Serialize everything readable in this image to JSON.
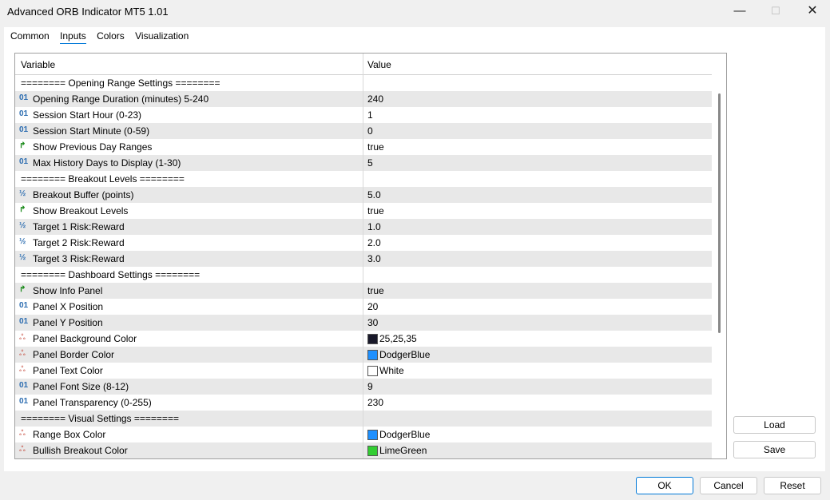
{
  "window": {
    "title": "Advanced ORB Indicator MT5 1.01",
    "minimize": "—",
    "maximize": "☐",
    "close": "✕"
  },
  "tabs": [
    {
      "label": "Common"
    },
    {
      "label": "Inputs",
      "active": true
    },
    {
      "label": "Colors"
    },
    {
      "label": "Visualization"
    }
  ],
  "grid": {
    "header": {
      "variable": "Variable",
      "value": "Value"
    },
    "rows": [
      {
        "type": "section",
        "variable": "======== Opening Range Settings ========",
        "value": ""
      },
      {
        "type": "int",
        "icon": "int-icon",
        "glyph": "01",
        "variable": "Opening Range Duration (minutes) 5-240",
        "value": "240"
      },
      {
        "type": "int",
        "icon": "int-icon",
        "glyph": "01",
        "variable": "Session Start Hour (0-23)",
        "value": "1"
      },
      {
        "type": "int",
        "icon": "int-icon",
        "glyph": "01",
        "variable": "Session Start Minute (0-59)",
        "value": "0"
      },
      {
        "type": "bool",
        "icon": "bool-icon",
        "glyph": "↱",
        "variable": "Show Previous Day Ranges",
        "value": "true"
      },
      {
        "type": "int",
        "icon": "int-icon",
        "glyph": "01",
        "variable": "Max History Days to Display (1-30)",
        "value": "5"
      },
      {
        "type": "section",
        "variable": "======== Breakout Levels ========",
        "value": ""
      },
      {
        "type": "double",
        "icon": "double-icon",
        "glyph": "½",
        "variable": "Breakout Buffer (points)",
        "value": "5.0"
      },
      {
        "type": "bool",
        "icon": "bool-icon",
        "glyph": "↱",
        "variable": "Show Breakout Levels",
        "value": "true"
      },
      {
        "type": "double",
        "icon": "double-icon",
        "glyph": "½",
        "variable": "Target 1 Risk:Reward",
        "value": "1.0"
      },
      {
        "type": "double",
        "icon": "double-icon",
        "glyph": "½",
        "variable": "Target 2 Risk:Reward",
        "value": "2.0"
      },
      {
        "type": "double",
        "icon": "double-icon",
        "glyph": "½",
        "variable": "Target 3 Risk:Reward",
        "value": "3.0"
      },
      {
        "type": "section",
        "variable": "======== Dashboard Settings ========",
        "value": ""
      },
      {
        "type": "bool",
        "icon": "bool-icon",
        "glyph": "↱",
        "variable": "Show Info Panel",
        "value": "true"
      },
      {
        "type": "int",
        "icon": "int-icon",
        "glyph": "01",
        "variable": "Panel X Position",
        "value": "20"
      },
      {
        "type": "int",
        "icon": "int-icon",
        "glyph": "01",
        "variable": "Panel Y Position",
        "value": "30"
      },
      {
        "type": "color",
        "icon": "color-icon",
        "glyph": "ஃ",
        "variable": "Panel Background Color",
        "value": "25,25,35",
        "swatch": "#19192a"
      },
      {
        "type": "color",
        "icon": "color-icon",
        "glyph": "ஃ",
        "variable": "Panel Border Color",
        "value": "DodgerBlue",
        "swatch": "#1e90ff"
      },
      {
        "type": "color",
        "icon": "color-icon",
        "glyph": "ஃ",
        "variable": "Panel Text Color",
        "value": "White",
        "swatch": "#ffffff"
      },
      {
        "type": "int",
        "icon": "int-icon",
        "glyph": "01",
        "variable": "Panel Font Size (8-12)",
        "value": "9"
      },
      {
        "type": "int",
        "icon": "int-icon",
        "glyph": "01",
        "variable": "Panel Transparency (0-255)",
        "value": "230"
      },
      {
        "type": "section",
        "variable": "======== Visual Settings ========",
        "value": ""
      },
      {
        "type": "color",
        "icon": "color-icon",
        "glyph": "ஃ",
        "variable": "Range Box Color",
        "value": "DodgerBlue",
        "swatch": "#1e90ff"
      },
      {
        "type": "color",
        "icon": "color-icon",
        "glyph": "ஃ",
        "variable": "Bullish Breakout Color",
        "value": "LimeGreen",
        "swatch": "#32cd32"
      }
    ]
  },
  "side_buttons": {
    "load": "Load",
    "save": "Save"
  },
  "footer_buttons": {
    "ok": "OK",
    "cancel": "Cancel",
    "reset": "Reset"
  },
  "colors": {
    "int_icon": "#2b6cb0",
    "bool_icon": "#1a8a1a",
    "double_icon": "#2b6cb0",
    "accent": "#0078d7"
  }
}
